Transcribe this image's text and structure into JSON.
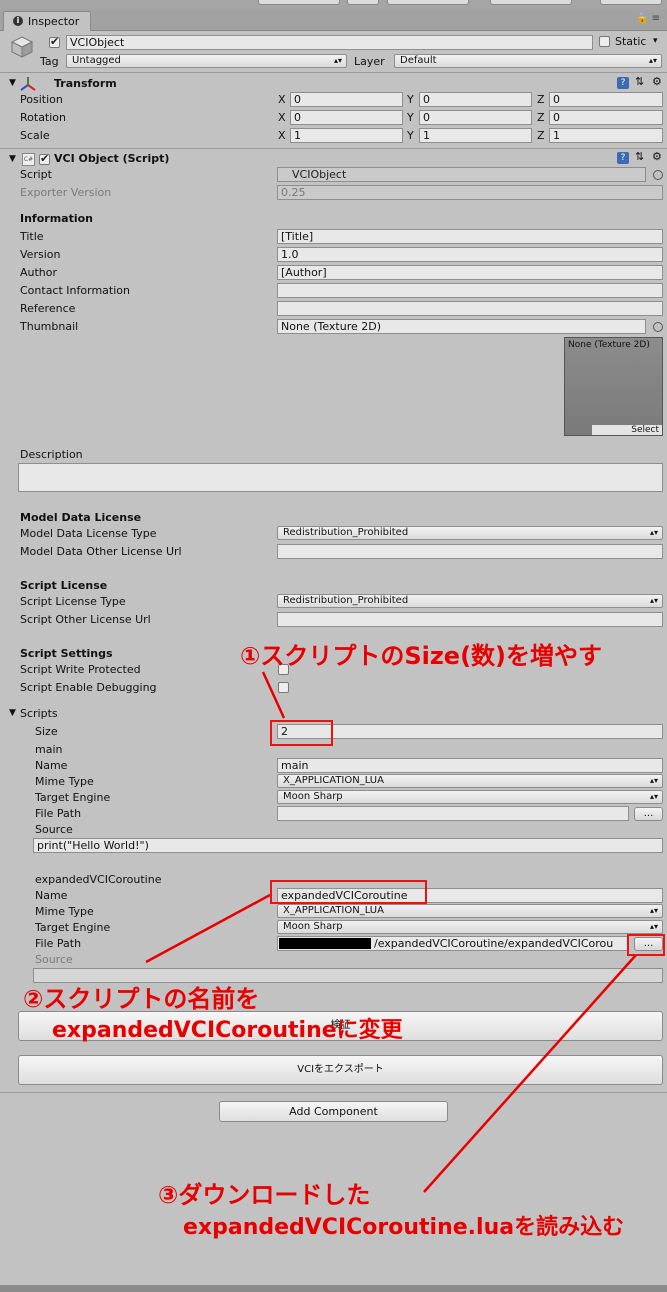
{
  "window": {
    "tab_label": "Inspector",
    "lock_menu": "🔒 ≡"
  },
  "object": {
    "name": "VCIObject",
    "static_label": "Static",
    "tag_label": "Tag",
    "tag_value": "Untagged",
    "layer_label": "Layer",
    "layer_value": "Default"
  },
  "transform": {
    "title": "Transform",
    "rows": [
      {
        "label": "Position",
        "x": "0",
        "y": "0",
        "z": "0"
      },
      {
        "label": "Rotation",
        "x": "0",
        "y": "0",
        "z": "0"
      },
      {
        "label": "Scale",
        "x": "1",
        "y": "1",
        "z": "1"
      }
    ],
    "axis_x": "X",
    "axis_y": "Y",
    "axis_z": "Z"
  },
  "vci": {
    "title": "VCI Object (Script)",
    "script_label": "Script",
    "script_value": "VCIObject",
    "exporter_label": "Exporter Version",
    "exporter_value": "0.25",
    "information_header": "Information",
    "title_label": "Title",
    "title_value": "[Title]",
    "version_label": "Version",
    "version_value": "1.0",
    "author_label": "Author",
    "author_value": "[Author]",
    "contact_label": "Contact Information",
    "contact_value": "",
    "reference_label": "Reference",
    "reference_value": "",
    "thumbnail_label": "Thumbnail",
    "thumbnail_value": "None (Texture 2D)",
    "thumb_preview_label": "None (Texture 2D)",
    "thumb_select": "Select",
    "description_label": "Description",
    "model_header": "Model Data License",
    "model_type_label": "Model Data License Type",
    "model_type_value": "Redistribution_Prohibited",
    "model_other_label": "Model Data Other License Url",
    "script_license_header": "Script License",
    "script_license_type_label": "Script License Type",
    "script_license_type_value": "Redistribution_Prohibited",
    "script_other_label": "Script Other License Url",
    "script_settings_header": "Script Settings",
    "write_protected_label": "Script Write Protected",
    "enable_debugging_label": "Script Enable Debugging",
    "scripts_label": "Scripts",
    "size_label": "Size",
    "size_value": "2",
    "script1": {
      "header": "main",
      "name_label": "Name",
      "name_value": "main",
      "mime_label": "Mime Type",
      "mime_value": "X_APPLICATION_LUA",
      "engine_label": "Target Engine",
      "engine_value": "Moon Sharp",
      "path_label": "File Path",
      "path_value": "",
      "browse": "...",
      "source_label": "Source",
      "source_value": "print(\"Hello World!\")"
    },
    "script2": {
      "header": "expandedVCICoroutine",
      "name_label": "Name",
      "name_value": "expandedVCICoroutine",
      "mime_label": "Mime Type",
      "mime_value": "X_APPLICATION_LUA",
      "engine_label": "Target Engine",
      "engine_value": "Moon Sharp",
      "path_label": "File Path",
      "path_value": "/expandedVCICoroutine/expandedVCICorou",
      "browse": "...",
      "source_label": "Source"
    },
    "verify_button": "検証",
    "export_button": "VCIをエクスポート"
  },
  "add_component": "Add Component",
  "annotations": {
    "a1": "①スクリプトのSize(数)を増やす",
    "a2_line1": "②スクリプトの名前を",
    "a2_line2": "expandedVCICoroutineに変更",
    "a3_line1": "③ダウンロードした",
    "a3_line2": "expandedVCICoroutine.luaを読み込む"
  },
  "colors": {
    "annotation": "#e80000",
    "panel": "#c2c2c2"
  }
}
